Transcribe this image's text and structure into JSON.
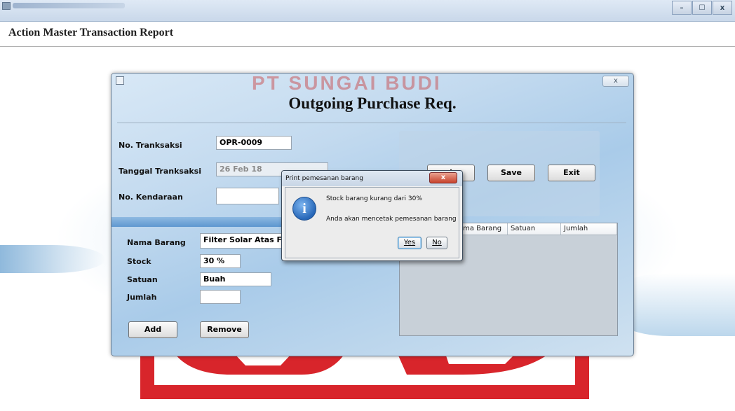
{
  "window": {
    "title": "",
    "min_label": "–",
    "max_label": "☐",
    "close_label": "x"
  },
  "report": {
    "title": "Action Master Transaction Report"
  },
  "form": {
    "watermark": "PT SUNGAI BUDI",
    "title": "Outgoing Purchase Req.",
    "close_glyph": "x",
    "no_transaksi_label": "No. Tranksaksi",
    "no_transaksi_value": "OPR-0009",
    "tanggal_label": "Tanggal Tranksaksi",
    "tanggal_value": "26 Feb 18",
    "kendaraan_label": "No. Kendaraan",
    "kendaraan_value": "",
    "nama_barang_label": "Nama Barang",
    "nama_barang_value": "Filter Solar Atas FR",
    "stock_label": "Stock",
    "stock_value": "30 %",
    "satuan_label": "Satuan",
    "satuan_value": "Buah",
    "jumlah_label": "Jumlah",
    "jumlah_value": "",
    "add_label": "Add",
    "remove_label": "Remove",
    "cancel_partial_label": "l",
    "save_label": "Save",
    "exit_label": "Exit",
    "table_headers": [
      "",
      "ama Barang",
      "Satuan",
      "Jumlah"
    ]
  },
  "dialog": {
    "title": "Print pemesanan barang",
    "close_glyph": "x",
    "message1": "Stock barang kurang dari 30%",
    "message2": "Anda akan mencetak pemesanan barang",
    "yes_label": "Yes",
    "no_label": "No",
    "icon": "info-icon"
  }
}
